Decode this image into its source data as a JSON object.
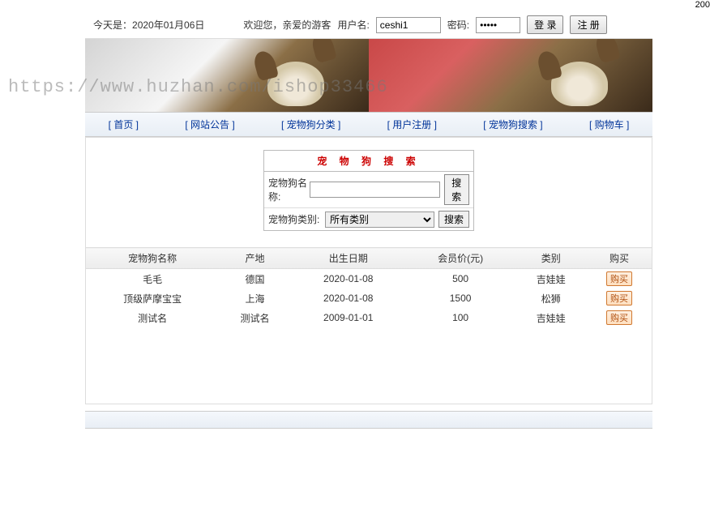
{
  "page_top_right": "200",
  "header": {
    "date_label": "今天是：",
    "date_value": "2020年01月06日",
    "welcome": "欢迎您，亲爱的游客",
    "username_label": "用户名:",
    "username_value": "ceshi1",
    "password_label": "密码:",
    "password_value": "•••••",
    "login_btn": "登 录",
    "register_btn": "注 册"
  },
  "watermark": "https://www.huzhan.com/ishop33466",
  "nav": [
    {
      "label": "[ 首页 ]"
    },
    {
      "label": "[ 网站公告 ]"
    },
    {
      "label": "[ 宠物狗分类 ]"
    },
    {
      "label": "[ 用户注册 ]"
    },
    {
      "label": "[ 宠物狗搜索 ]"
    },
    {
      "label": "[ 购物车 ]"
    }
  ],
  "search": {
    "title": "宠 物 狗 搜 索",
    "name_label": "宠物狗名称:",
    "name_value": "",
    "type_label": "宠物狗类别:",
    "type_selected": "所有类别",
    "search_btn": "搜索"
  },
  "table": {
    "headers": [
      "宠物狗名称",
      "产地",
      "出生日期",
      "会员价(元)",
      "类别",
      "购买"
    ],
    "rows": [
      {
        "name": "毛毛",
        "origin": "德国",
        "birth": "2020-01-08",
        "price": "500",
        "category": "吉娃娃",
        "buy": "购买"
      },
      {
        "name": "顶级萨摩宝宝",
        "origin": "上海",
        "birth": "2020-01-08",
        "price": "1500",
        "category": "松狮",
        "buy": "购买"
      },
      {
        "name": "测试名",
        "origin": "测试名",
        "birth": "2009-01-01",
        "price": "100",
        "category": "吉娃娃",
        "buy": "购买"
      }
    ]
  }
}
